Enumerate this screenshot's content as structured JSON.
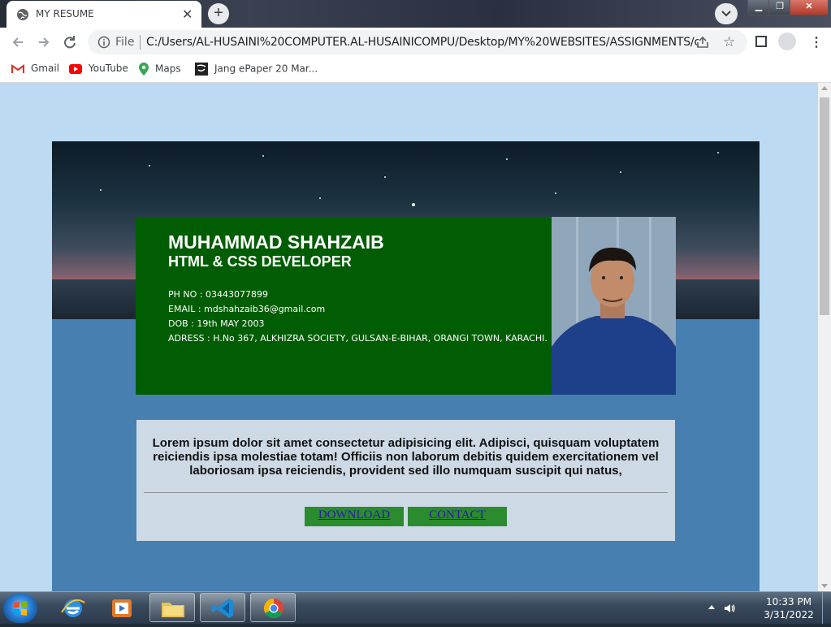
{
  "browser": {
    "tab_title": "MY RESUME",
    "new_tab_label": "+",
    "file_label": "File",
    "url": "C:/Users/AL-HUSAINI%20COMPUTER.AL-HUSAINICOMPU/Desktop/MY%20WEBSITES/ASSIGNMENTS/cv%...",
    "bookmarks": [
      "Gmail",
      "YouTube",
      "Maps",
      "Jang ePaper 20 Mar..."
    ]
  },
  "resume": {
    "name": "MUHAMMAD SHAHZAIB",
    "role": "HTML & CSS DEVELOPER",
    "phone": "PH NO : 03443077899",
    "email": "EMAIL : mdshahzaib36@gmail.com",
    "dob": "DOB : 19th MAY 2003",
    "address": "ADRESS : H.No 367, ALKHIZRA SOCIETY, GULSAN-E-BIHAR, ORANGI TOWN, KARACHI.",
    "about": "Lorem ipsum dolor sit amet consectetur adipisicing elit. Adipisci, quisquam voluptatem reiciendis ipsa molestiae totam! Officiis non laborum debitis quidem exercitationem vel laboriosam ipsa reiciendis, provident sed illo numquam suscipit qui natus,",
    "download_label": "DOWNLOAD",
    "contact_label": "CONTACT"
  },
  "taskbar": {
    "time": "10:33 PM",
    "date": "3/31/2022"
  },
  "colors": {
    "page_bg": "#bcdaf1",
    "card_green": "#015d03",
    "content_blue": "#467fb0",
    "button_green": "#2a8b2f"
  }
}
